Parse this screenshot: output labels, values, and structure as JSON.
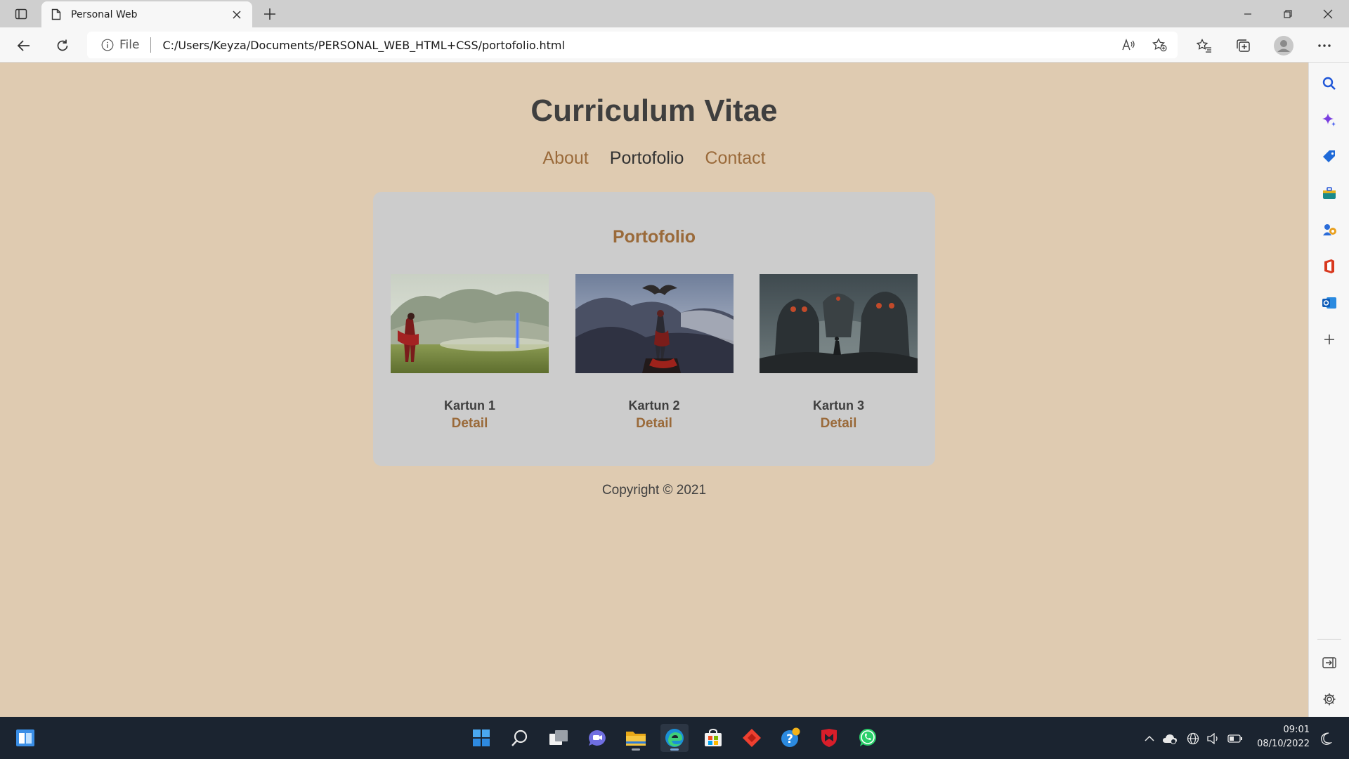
{
  "browser": {
    "tab_title": "Personal Web",
    "address_info": "File",
    "url": "C:/Users/Keyza/Documents/PERSONAL_WEB_HTML+CSS/portofolio.html"
  },
  "site": {
    "title": "Curriculum Vitae",
    "nav": [
      {
        "label": "About",
        "active": false
      },
      {
        "label": "Portofolio",
        "active": true
      },
      {
        "label": "Contact",
        "active": false
      }
    ],
    "section_title": "Portofolio",
    "items": [
      {
        "name": "Kartun 1",
        "link": "Detail",
        "image": "girl-in-red-meadow-illustration"
      },
      {
        "name": "Kartun 2",
        "link": "Detail",
        "image": "figure-with-eagle-mountain-illustration"
      },
      {
        "name": "Kartun 3",
        "link": "Detail",
        "image": "giant-robots-ruins-illustration"
      }
    ],
    "footer": "Copyright © 2021"
  },
  "taskbar": {
    "time": "09:01",
    "date": "08/10/2022"
  },
  "colors": {
    "page_bg": "#dfcbb1",
    "card_bg": "#cccccc",
    "accent": "#9a6a3a",
    "text": "#3f3f3f"
  }
}
